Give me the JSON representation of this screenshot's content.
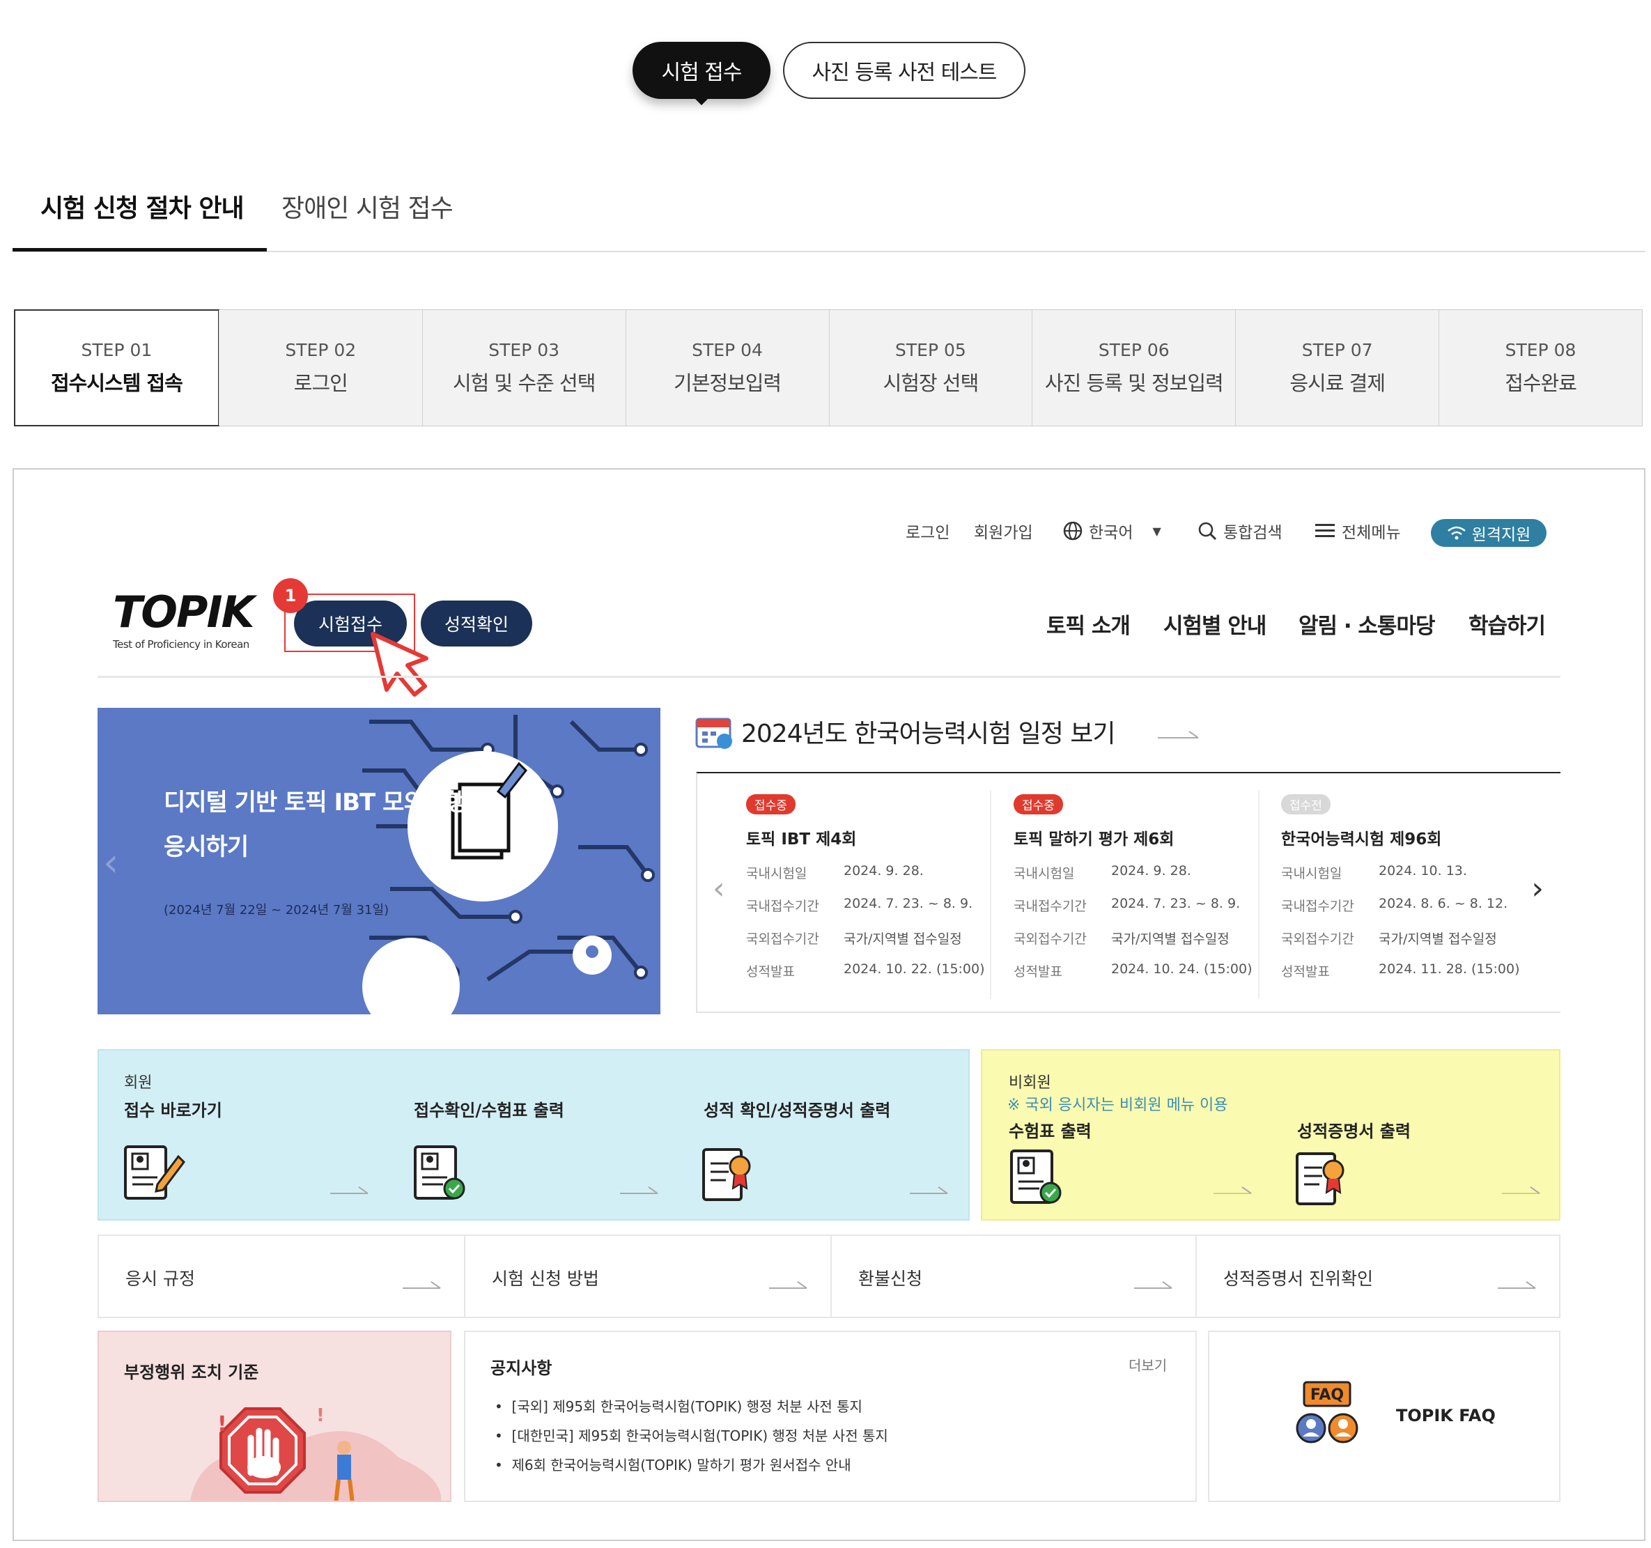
{
  "top_tabs": {
    "active": "시험 접수",
    "other": "사진 등록 사전 테스트"
  },
  "sub_tabs": [
    "시험 신청 절차 안내",
    "장애인 시험 접수"
  ],
  "steps": [
    {
      "num": "STEP 01",
      "label": "접수시스템 접속"
    },
    {
      "num": "STEP 02",
      "label": "로그인"
    },
    {
      "num": "STEP 03",
      "label": "시험 및 수준 선택"
    },
    {
      "num": "STEP 04",
      "label": "기본정보입력"
    },
    {
      "num": "STEP 05",
      "label": "시험장 선택"
    },
    {
      "num": "STEP 06",
      "label": "사진 등록 및 정보입력"
    },
    {
      "num": "STEP 07",
      "label": "응시료 결제"
    },
    {
      "num": "STEP 08",
      "label": "접수완료"
    }
  ],
  "site": {
    "util": {
      "login": "로그인",
      "join": "회원가입",
      "lang": "한국어",
      "search": "통합검색",
      "menu": "전체메뉴",
      "remote": "원격지원"
    },
    "logo": {
      "mark": "TOPIK",
      "sub": "Test of Proficiency in Korean"
    },
    "callout_num": "1",
    "btn_apply": "시험접수",
    "btn_score": "성적확인",
    "gnb": [
      "토픽 소개",
      "시험별 안내",
      "알림 · 소통마당",
      "학습하기"
    ],
    "banner": {
      "title1": "디지털 기반 토픽 IBT 모의시행",
      "title2": "응시하기",
      "period": "(2024년 7월 22일 ~ 2024년 7월 31일)"
    },
    "schedule_title": "2024년도 한국어능력시험 일정 보기",
    "schedule": [
      {
        "badge": "접수중",
        "name": "토픽 IBT 제4회",
        "rows": [
          [
            "국내시험일",
            "2024. 9. 28."
          ],
          [
            "국내접수기간",
            "2024. 7. 23. ~ 8. 9."
          ],
          [
            "국외접수기간",
            "국가/지역별 접수일정"
          ],
          [
            "성적발표",
            "2024. 10. 22. (15:00)"
          ]
        ]
      },
      {
        "badge": "접수중",
        "name": "토픽 말하기 평가 제6회",
        "rows": [
          [
            "국내시험일",
            "2024. 9. 28."
          ],
          [
            "국내접수기간",
            "2024. 7. 23. ~ 8. 9."
          ],
          [
            "국외접수기간",
            "국가/지역별 접수일정"
          ],
          [
            "성적발표",
            "2024. 10. 24. (15:00)"
          ]
        ]
      },
      {
        "badge": "접수전",
        "name": "한국어능력시험 제96회",
        "rows": [
          [
            "국내시험일",
            "2024. 10. 13."
          ],
          [
            "국내접수기간",
            "2024. 8. 6. ~ 8. 12."
          ],
          [
            "국외접수기간",
            "국가/지역별 접수일정"
          ],
          [
            "성적발표",
            "2024. 11. 28. (15:00)"
          ]
        ]
      }
    ],
    "member": {
      "label": "회원",
      "items": [
        "접수 바로가기",
        "접수확인/수험표 출력",
        "성적 확인/성적증명서 출력"
      ]
    },
    "nonmember": {
      "label": "비회원",
      "note": "※ 국외 응시자는 비회원 메뉴 이용",
      "items": [
        "수험표 출력",
        "성적증명서 출력"
      ]
    },
    "links": [
      "응시 규정",
      "시험 신청 방법",
      "환불신청",
      "성적증명서 진위확인"
    ],
    "fraud": "부정행위 조치 기준",
    "notice": {
      "title": "공지사항",
      "more": "더보기",
      "items": [
        "[국외] 제95회 한국어능력시험(TOPIK) 행정 처분 사전 통지",
        "[대한민국] 제95회 한국어능력시험(TOPIK) 행정 처분 사전 통지",
        "제6회 한국어능력시험(TOPIK) 말하기 평가 원서접수 안내"
      ]
    },
    "faq": {
      "badge": "FAQ",
      "label": "TOPIK FAQ"
    }
  }
}
